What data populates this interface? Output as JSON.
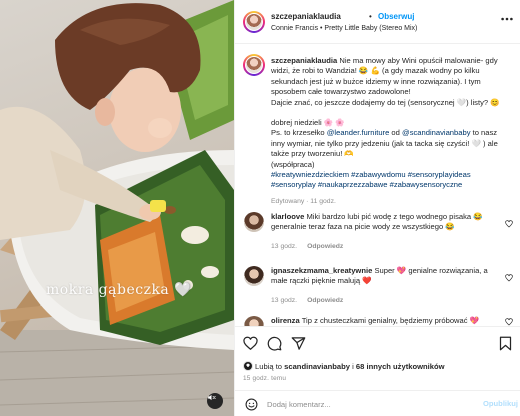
{
  "header": {
    "username": "szczepaniaklaudia",
    "separator": "•",
    "follow_label": "Obserwuj",
    "audio": "Connie Francis • Pretty Little Baby (Stereo Mix)",
    "more_icon": "more-horizontal-icon"
  },
  "media": {
    "overlay_text": "mokra gąbeczka 🤍",
    "audio_icon": "muted-speaker-icon"
  },
  "caption": {
    "username": "szczepaniaklaudia",
    "p1": "Nie ma mowy aby Wini opuścił malowanie- gdy widzi, że robi to Wandzia! 😂 💪 (a gdy mazak wodny po kilku sekundach jest już w bużce idziemy w inne rozwiązania). I tym sposobem całe towarzystwo zadowolone!",
    "p2": "Dajcie znać, co jeszcze dodajemy do tej (sensorycznej 🤍) listy? 😊",
    "p3": "dobrej niedzieli 🌸 🌸",
    "p4_start": "Ps. to krzesełko ",
    "p4_link1": "@leander.furniture",
    "p4_mid": " od ",
    "p4_link2": "@scandinavianbaby",
    "p4_end": " to nasz inny wymiar, nie tylko przy jedzeniu (jak ta tacka się czyści! 🤍 ) ale także przy tworzeniu! 🫶",
    "p5": "(współpraca)",
    "hashtags": "#kreatywniezdzieckiem #zabawywdomu #sensoryplayideas #sensoryplay #naukaprzezzabawe #zabawysensoryczne",
    "meta": "Edytowany",
    "age": "11 godz."
  },
  "comments": [
    {
      "username": "klarloove",
      "text": "Miki bardzo lubi pić wodę z tego wodnego pisaka 😂 generalnie teraz faza na picie wody ze wszystkiego 😂",
      "time": "13 godz.",
      "reply_label": "Odpowiedz"
    },
    {
      "username": "ignaszekzmama_kreatywnie",
      "text": "Super 💖 genialne rozwiązania, a małe rączki pięknie malują ❤️",
      "time": "13 godz.",
      "reply_label": "Odpowiedz"
    },
    {
      "username": "olirenza",
      "text": "Tip z chusteczkami genialny, będziemy próbować 💖",
      "time": "",
      "reply_label": ""
    }
  ],
  "actions": {
    "like_icon": "heart-icon",
    "comment_icon": "comment-icon",
    "share_icon": "send-icon",
    "save_icon": "bookmark-icon"
  },
  "likes": {
    "prefix": "Lubią to ",
    "user": "scandinavianbaby",
    "mid": " i ",
    "others": "68 innych użytkowników"
  },
  "timestamp": "15 godz. temu",
  "add_comment": {
    "placeholder": "Dodaj komentarz...",
    "publish_label": "Opublikuj",
    "emoji_icon": "emoji-icon"
  },
  "colors": {
    "accent": "#0095f6",
    "link": "#00376b",
    "muted": "#8e8e8e",
    "text": "#262626",
    "like_red": "#ed4956"
  }
}
